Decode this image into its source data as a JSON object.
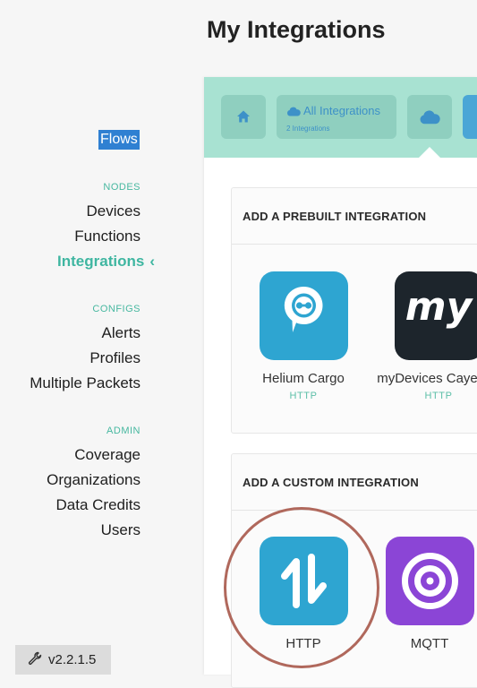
{
  "header": {
    "title": "My Integrations"
  },
  "sidebar": {
    "flows": "Flows",
    "sections": {
      "nodes": "NODES",
      "configs": "CONFIGS",
      "admin": "ADMIN"
    },
    "items": {
      "devices": "Devices",
      "functions": "Functions",
      "integrations": "Integrations",
      "alerts": "Alerts",
      "profiles": "Profiles",
      "multiple_packets": "Multiple Packets",
      "coverage": "Coverage",
      "organizations": "Organizations",
      "data_credits": "Data Credits",
      "users": "Users"
    },
    "active_item": "Integrations",
    "active_chevron": "‹",
    "version": "v2.2.1.5"
  },
  "tabs": {
    "all_label": "All Integrations",
    "all_count": "2 Integrations"
  },
  "prebuilt": {
    "title": "ADD A PREBUILT INTEGRATION",
    "items": [
      {
        "name": "Helium Cargo",
        "type": "HTTP",
        "icon": "helium-cargo-icon"
      },
      {
        "name": "myDevices Cayenne",
        "type": "HTTP",
        "icon": "mydevices-icon",
        "icon_text": "my"
      }
    ]
  },
  "custom": {
    "title": "ADD A CUSTOM INTEGRATION",
    "items": [
      {
        "name": "HTTP",
        "icon": "http-arrows-icon"
      },
      {
        "name": "MQTT",
        "icon": "mqtt-target-icon"
      }
    ]
  },
  "colors": {
    "accent": "#3fb6a1",
    "tabbar": "#a8e2d2",
    "selection": "#2f80d2",
    "helium_blue": "#2ea5d1",
    "mydevices_dark": "#1d252c",
    "mqtt_purple": "#8b45d6",
    "highlight": "#b0685c"
  }
}
